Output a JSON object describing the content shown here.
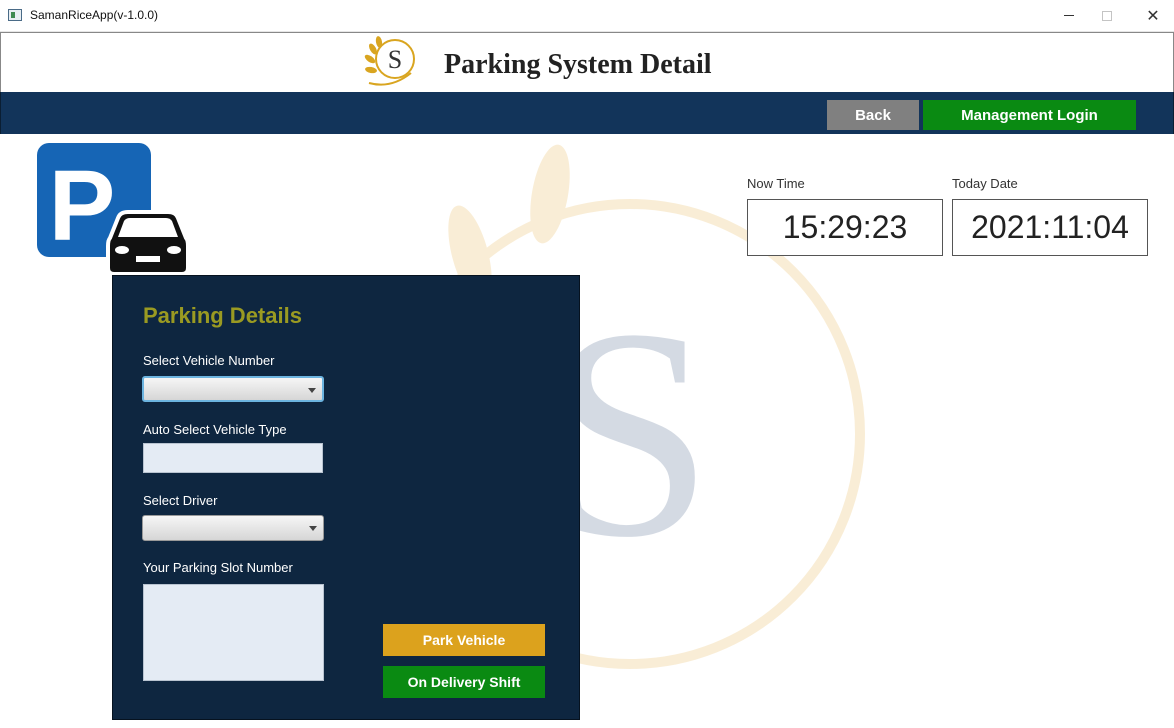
{
  "window": {
    "title": "SamanRiceApp(v-1.0.0)",
    "minimize_icon": "minimize-icon",
    "maximize_icon": "maximize-icon",
    "close_glyph": "✕"
  },
  "header": {
    "logo_letter": "S",
    "title": "Parking System Detail"
  },
  "navbar": {
    "back_label": "Back",
    "login_label": "Management Login"
  },
  "clock": {
    "time_label": "Now Time",
    "time_value": "15:29:23",
    "date_label": "Today Date",
    "date_value": "2021:11:04"
  },
  "parking_icon": {
    "letter": "P"
  },
  "panel": {
    "title": "Parking Details",
    "vehicle_number_label": "Select Vehicle Number",
    "vehicle_number_value": "",
    "vehicle_type_label": "Auto Select Vehicle Type",
    "vehicle_type_value": "",
    "driver_label": "Select Driver",
    "driver_value": "",
    "slot_label": "Your Parking Slot Number",
    "slot_value": "",
    "park_button": "Park Vehicle",
    "delivery_button": "On Delivery Shift"
  },
  "colors": {
    "navbar": "#12345a",
    "panel": "#0e2640",
    "panel_title": "#9a9a22",
    "green_button": "#0a8a12",
    "gold_button": "#dca21d",
    "grey_button": "#808080"
  }
}
